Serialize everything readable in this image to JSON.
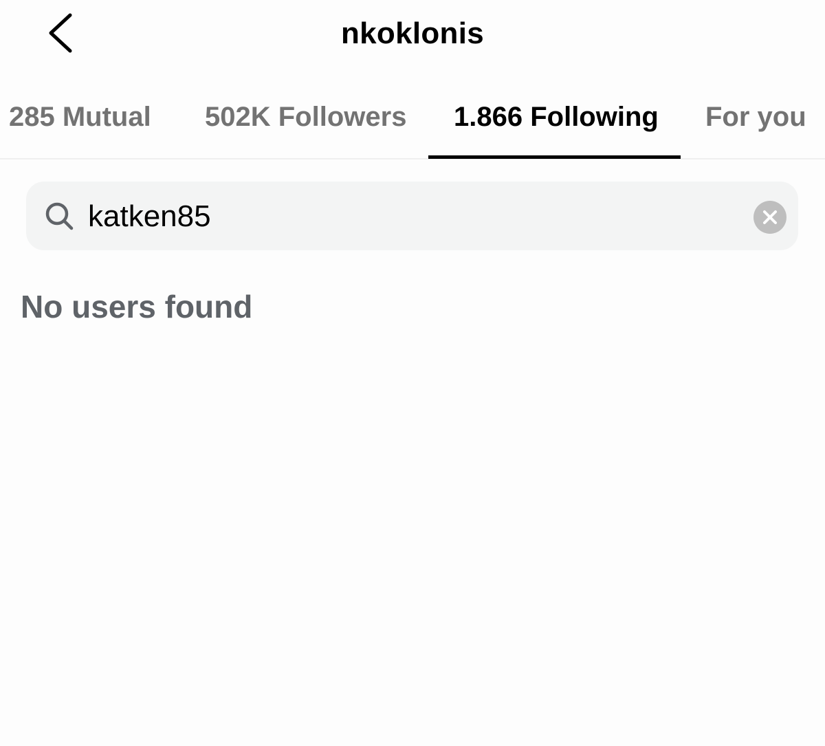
{
  "header": {
    "back_icon": "chevron-left-icon",
    "username": "nkoklonis"
  },
  "tabs": [
    {
      "label": "285 Mutual",
      "active": false
    },
    {
      "label": "502K Followers",
      "active": false
    },
    {
      "label": "1.866 Following",
      "active": true
    },
    {
      "label": "For you",
      "active": false
    }
  ],
  "search": {
    "icon": "search-icon",
    "value": "katken85",
    "clear_icon": "clear-icon"
  },
  "results": {
    "empty_message": "No users found"
  },
  "colors": {
    "background": "#fdfdfd",
    "active_text": "#000000",
    "inactive_text": "#737373",
    "search_background": "#f3f4f4",
    "clear_button": "#bebebe"
  }
}
